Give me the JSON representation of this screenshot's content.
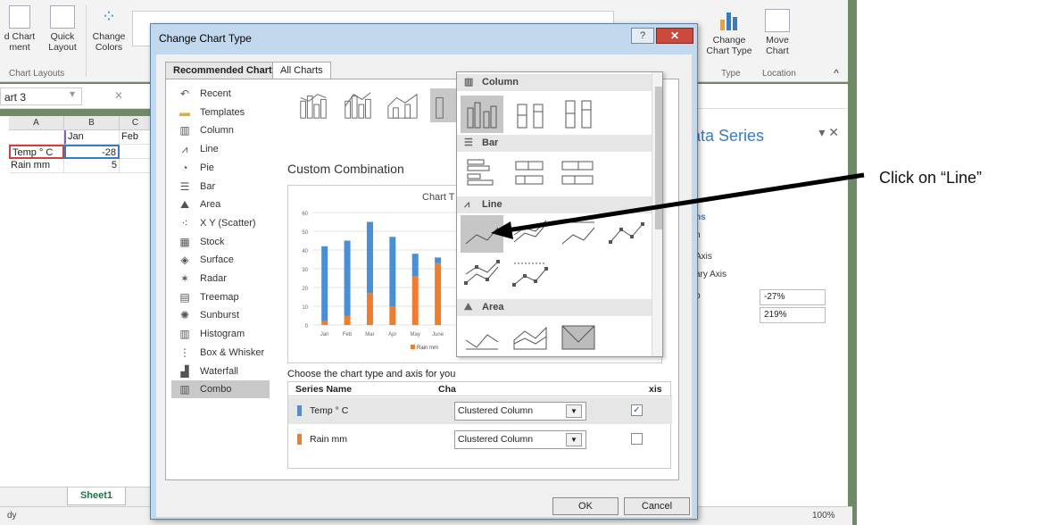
{
  "ribbon": {
    "chart_layouts": {
      "add_chart_element": "d Chart\nment",
      "quick_layout": "Quick\nLayout",
      "group_label": "Chart Layouts"
    },
    "change_colors": "Change\nColors",
    "change_chart_type": "Change\nChart Type",
    "move_chart": "Move\nChart",
    "type_label": "Type",
    "location_label": "Location"
  },
  "formula_bar": {
    "name_box": "art 3",
    "fx": "fx"
  },
  "grid": {
    "columns": [
      "A",
      "B",
      "C"
    ],
    "rows": [
      {
        "a": "",
        "b": "Jan",
        "c": "Feb"
      },
      {
        "a": "Temp ° C",
        "b": "-28",
        "c": ""
      },
      {
        "a": "Rain mm",
        "b": "5",
        "c": ""
      }
    ]
  },
  "sheet_tab": "Sheet1",
  "status": "dy",
  "pane": {
    "title": "ata Series",
    "items": [
      "ns",
      "n",
      "Axis",
      "ary Axis",
      "p"
    ],
    "gap_value": "-27%",
    "overlap_value": "219%"
  },
  "zoom": "100%",
  "dialog": {
    "title": "Change Chart Type",
    "help": "?",
    "close": "✕",
    "tabs": [
      "Recommended Charts",
      "All Charts"
    ],
    "sidebar": [
      {
        "label": "Recent",
        "icon": "recent-icon"
      },
      {
        "label": "Templates",
        "icon": "folder-icon"
      },
      {
        "label": "Column",
        "icon": "column-icon"
      },
      {
        "label": "Line",
        "icon": "line-icon"
      },
      {
        "label": "Pie",
        "icon": "pie-icon"
      },
      {
        "label": "Bar",
        "icon": "bar-icon"
      },
      {
        "label": "Area",
        "icon": "area-icon"
      },
      {
        "label": "X Y (Scatter)",
        "icon": "scatter-icon"
      },
      {
        "label": "Stock",
        "icon": "stock-icon"
      },
      {
        "label": "Surface",
        "icon": "surface-icon"
      },
      {
        "label": "Radar",
        "icon": "radar-icon"
      },
      {
        "label": "Treemap",
        "icon": "treemap-icon"
      },
      {
        "label": "Sunburst",
        "icon": "sunburst-icon"
      },
      {
        "label": "Histogram",
        "icon": "histogram-icon"
      },
      {
        "label": "Box & Whisker",
        "icon": "box-whisker-icon"
      },
      {
        "label": "Waterfall",
        "icon": "waterfall-icon"
      },
      {
        "label": "Combo",
        "icon": "combo-icon"
      }
    ],
    "selected_sidebar": "Combo",
    "section_title": "Custom Combination",
    "chart_title": "Chart T",
    "choose_text": "Choose the chart type and axis for you",
    "table_headers": {
      "series": "Series Name",
      "type": "Cha",
      "axis": "xis"
    },
    "series_rows": [
      {
        "name": "Temp ° C",
        "type": "Clustered Column",
        "checked": true,
        "color": "#4a8fd4"
      },
      {
        "name": "Rain mm",
        "type": "Clustered Column",
        "checked": false,
        "color": "#ed7d31"
      }
    ],
    "ok": "OK",
    "cancel": "Cancel"
  },
  "dropdown": {
    "sections": [
      "Column",
      "Bar",
      "Line",
      "Area"
    ]
  },
  "annotation": "Click on “Line”",
  "chart_data": {
    "type": "bar",
    "categories": [
      "Jan",
      "Feb",
      "Mar",
      "Apr",
      "May",
      "June",
      "J"
    ],
    "series": [
      {
        "values": [
          2,
          5,
          17,
          10,
          26,
          33,
          41
        ]
      },
      {
        "values": [
          40,
          40,
          38,
          37,
          12,
          3,
          8
        ]
      }
    ],
    "ylim": [
      0,
      60
    ],
    "yticks": [
      0,
      10,
      20,
      30,
      40,
      50,
      60
    ],
    "legend_visible": [
      "Rain mm"
    ],
    "colors": [
      "#ed7d31",
      "#4a8fd4"
    ]
  }
}
